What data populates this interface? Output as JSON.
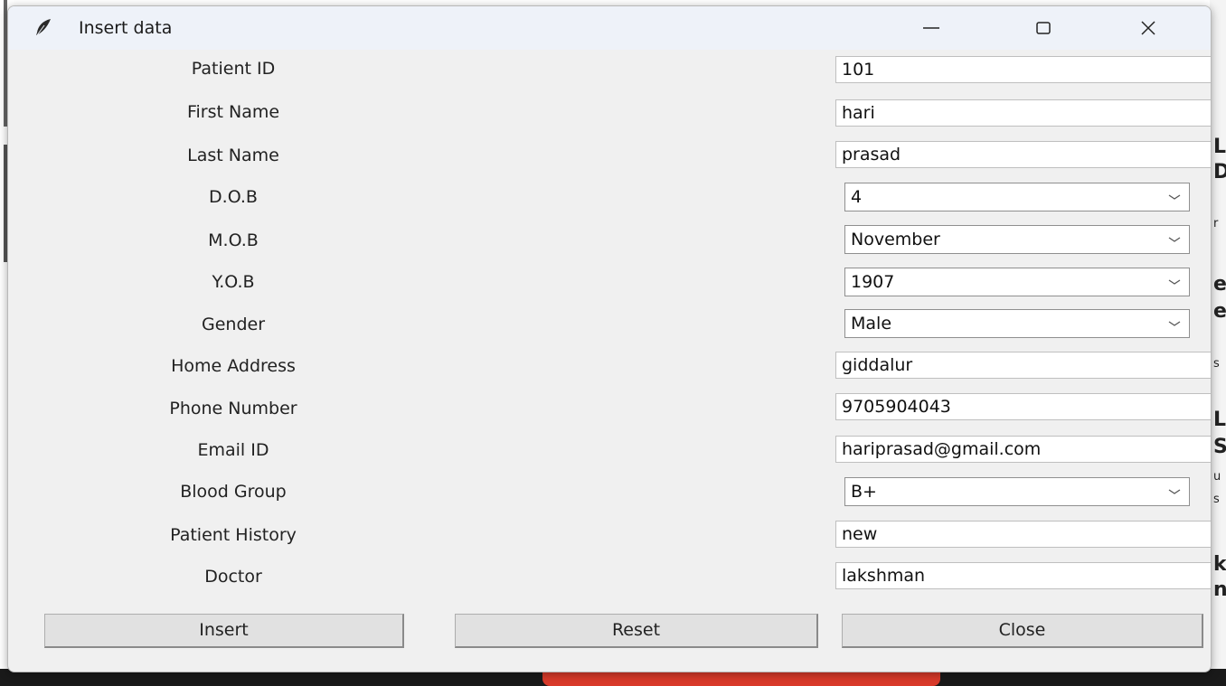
{
  "window": {
    "title": "Insert data",
    "minimize_icon": "minimize-icon",
    "maximize_icon": "maximize-icon",
    "close_icon": "close-icon",
    "app_icon": "feather-icon"
  },
  "form": {
    "patient_id": {
      "label": "Patient ID",
      "value": "101"
    },
    "first_name": {
      "label": "First Name",
      "value": "hari"
    },
    "last_name": {
      "label": "Last Name",
      "value": "prasad"
    },
    "dob": {
      "label": "D.O.B",
      "value": "4"
    },
    "mob": {
      "label": "M.O.B",
      "value": "November"
    },
    "yob": {
      "label": "Y.O.B",
      "value": "1907"
    },
    "gender": {
      "label": "Gender",
      "value": "Male"
    },
    "home_address": {
      "label": "Home Address",
      "value": "giddalur"
    },
    "phone_number": {
      "label": "Phone Number",
      "value": "9705904043"
    },
    "email_id": {
      "label": "Email ID",
      "value": "hariprasad@gmail.com"
    },
    "blood_group": {
      "label": "Blood Group",
      "value": "B+"
    },
    "patient_history": {
      "label": "Patient History",
      "value": "new"
    },
    "doctor": {
      "label": "Doctor",
      "value": "lakshman"
    }
  },
  "buttons": {
    "insert": "Insert",
    "reset": "Reset",
    "close": "Close"
  },
  "background": {
    "right_edge_glyphs": [
      "L",
      "D",
      "r",
      "e",
      "e",
      "s",
      "L",
      "S",
      "u",
      "s",
      "k",
      "n"
    ]
  },
  "colors": {
    "window_bg": "#f0f0f0",
    "titlebar_bg": "#eef2f9",
    "button_bg": "#e1e1e1",
    "accent_red": "#d93a2a"
  }
}
